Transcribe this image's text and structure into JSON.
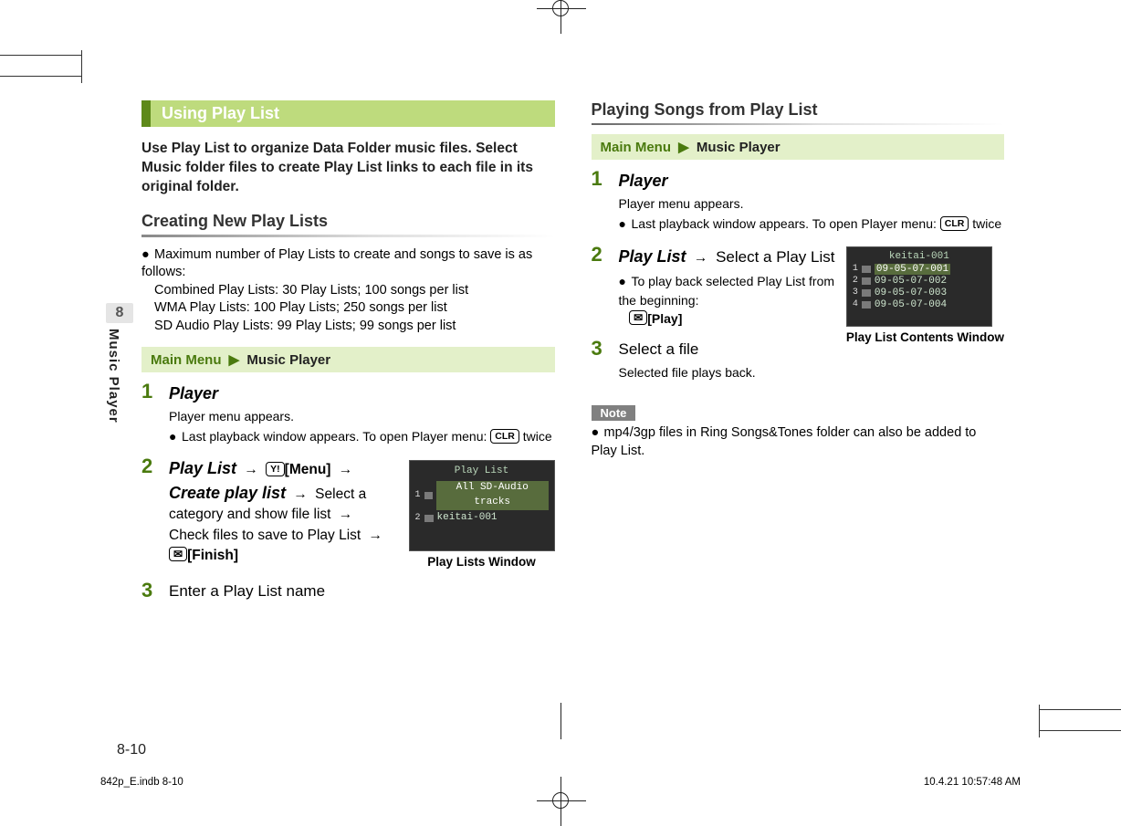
{
  "banner": "Using Play List",
  "intro": "Use Play List to organize Data Folder music files. Select Music folder files to create Play List links to each file in its original folder.",
  "left": {
    "subhead": "Creating New Play Lists",
    "limits": {
      "lead": "Maximum number of Play Lists to create and songs to save is as follows:",
      "l1": "Combined Play Lists: 30 Play Lists; 100 songs per list",
      "l2": "WMA Play Lists: 100 Play Lists; 250 songs per list",
      "l3": "SD Audio Play Lists: 99 Play Lists; 99 songs per list"
    },
    "nav": {
      "a": "Main Menu",
      "b": "Music Player"
    },
    "steps": {
      "s1": {
        "title": "Player",
        "sub": "Player menu appears.",
        "note": "Last playback window appears. To open Player menu: ",
        "key": "CLR",
        "twice": " twice"
      },
      "s2": {
        "playlist": "Play List",
        "menu": "[Menu]",
        "create": "Create play list",
        "rest1": " Select a category and show file list ",
        "rest2": " Check files to save to Play List ",
        "finish": "[Finish]",
        "ykey": "Y!"
      },
      "s3": {
        "title": "Enter a Play List name"
      }
    },
    "fig": {
      "title": "Play List",
      "row1": "All SD-Audio tracks",
      "row2": "keitai-001",
      "caption": "Play Lists Window"
    }
  },
  "right": {
    "subhead": "Playing Songs from Play List",
    "nav": {
      "a": "Main Menu",
      "b": "Music Player"
    },
    "steps": {
      "s1": {
        "title": "Player",
        "sub": "Player menu appears.",
        "note": "Last playback window appears. To open Player menu: ",
        "key": "CLR",
        "twice": " twice"
      },
      "s2": {
        "playlist": "Play List",
        "rest": " Select a Play List",
        "bullet": "To play back selected Play List from the beginning: ",
        "play": "[Play]"
      },
      "s3": {
        "title": "Select a file",
        "sub": "Selected file plays back."
      }
    },
    "fig": {
      "title": "keitai-001",
      "r1": "09-05-07-001",
      "r2": "09-05-07-002",
      "r3": "09-05-07-003",
      "r4": "09-05-07-004",
      "caption": "Play List Contents Window"
    },
    "note": {
      "label": "Note",
      "body": "mp4/3gp files in Ring Songs&Tones folder can also be added to Play List."
    }
  },
  "side": {
    "chapter": "8",
    "label": "Music Player"
  },
  "pagenum": "8-10",
  "footer": {
    "left": "842p_E.indb   8-10",
    "right": "10.4.21   10:57:48 AM"
  }
}
